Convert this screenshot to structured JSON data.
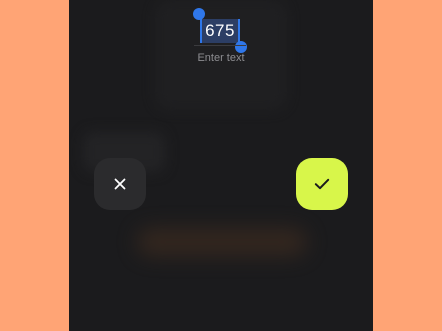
{
  "text_field": {
    "value": "675",
    "placeholder": "Enter text"
  },
  "icons": {
    "cancel": "close-icon",
    "confirm": "checkmark-icon"
  },
  "colors": {
    "side_background": "#ffa475",
    "screen_background": "#1b1b1d",
    "confirm_accent": "#d8f64a",
    "cancel_button": "#2b2b2d",
    "selection": "#2f77ea"
  }
}
